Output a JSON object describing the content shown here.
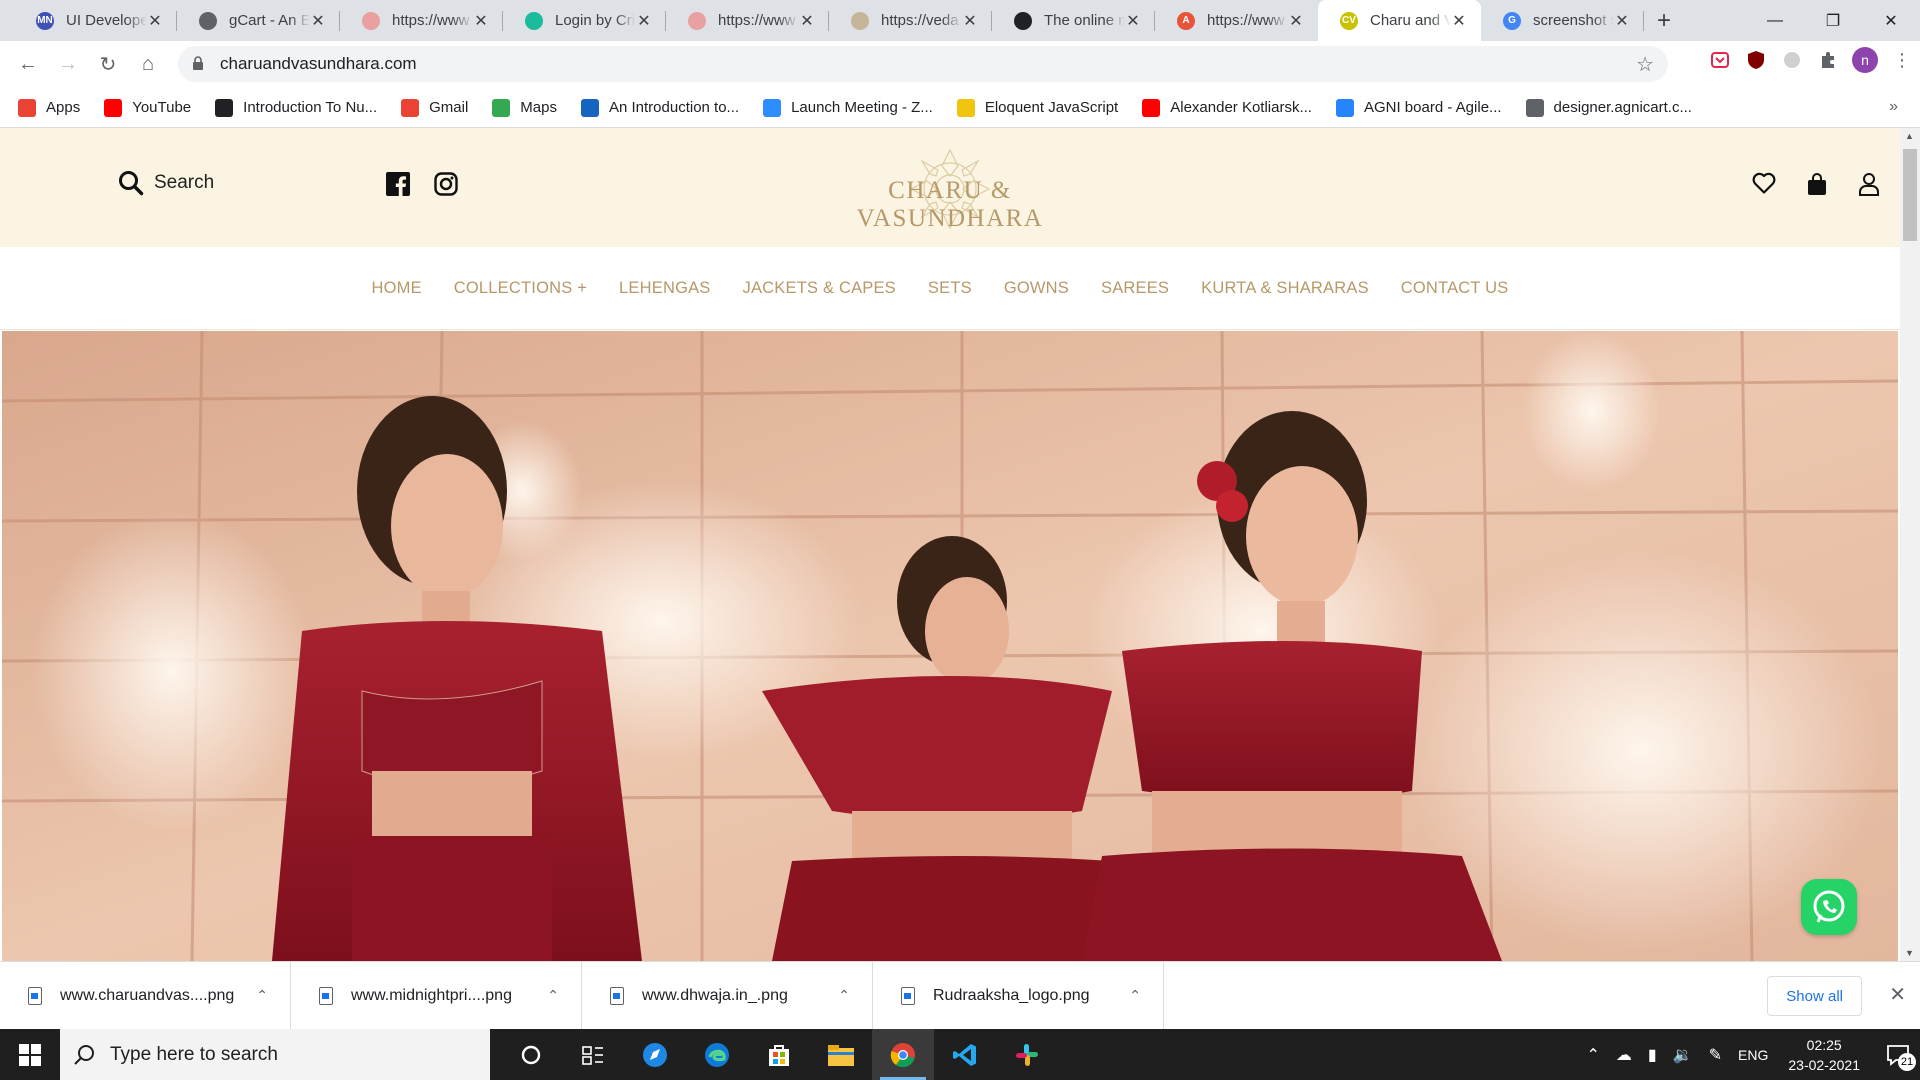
{
  "browser": {
    "tabs": [
      {
        "title": "UI Developer",
        "favicon_text": "MN",
        "favicon_color": "#3f51b5"
      },
      {
        "title": "gCart - An E",
        "favicon_text": "",
        "favicon_color": "#5f6368"
      },
      {
        "title": "https://www",
        "favicon_text": "",
        "favicon_color": "#e8a0a0"
      },
      {
        "title": "Login by Cri",
        "favicon_text": "",
        "favicon_color": "#1abc9c"
      },
      {
        "title": "https://www",
        "favicon_text": "",
        "favicon_color": "#e8a0a0"
      },
      {
        "title": "https://veda",
        "favicon_text": "",
        "favicon_color": "#c7b59a"
      },
      {
        "title": "The online m",
        "favicon_text": "",
        "favicon_color": "#202124"
      },
      {
        "title": "https://www",
        "favicon_text": "A",
        "favicon_color": "#e8533a"
      },
      {
        "title": "Charu and V",
        "favicon_text": "CV",
        "favicon_color": "#c9c200"
      },
      {
        "title": "screenshot s",
        "favicon_text": "G",
        "favicon_color": "#4285f4"
      }
    ],
    "active_tab_index": 8,
    "url": "charuandvasundhara.com",
    "profile_initial": "n",
    "bookmarks": [
      {
        "label": "Apps",
        "icon": "apps-grid-icon",
        "color": "#ea4335"
      },
      {
        "label": "YouTube",
        "icon": "youtube-icon",
        "color": "#ff0000"
      },
      {
        "label": "Introduction To Nu...",
        "icon": "bookmark-site-icon",
        "color": "#202124"
      },
      {
        "label": "Gmail",
        "icon": "gmail-icon",
        "color": "#ea4335"
      },
      {
        "label": "Maps",
        "icon": "maps-icon",
        "color": "#34a853"
      },
      {
        "label": "An Introduction to...",
        "icon": "s-icon",
        "color": "#1565c0"
      },
      {
        "label": "Launch Meeting - Z...",
        "icon": "zoom-icon",
        "color": "#2d8cff"
      },
      {
        "label": "Eloquent JavaScript",
        "icon": "ejs-icon",
        "color": "#f1c40f"
      },
      {
        "label": "Alexander Kotliarsk...",
        "icon": "youtube-icon",
        "color": "#ff0000"
      },
      {
        "label": "AGNI board - Agile...",
        "icon": "jira-icon",
        "color": "#2684ff"
      },
      {
        "label": "designer.agnicart.c...",
        "icon": "globe-icon",
        "color": "#5f6368"
      }
    ]
  },
  "site": {
    "search_label": "Search",
    "brand_name": "CHARU & VASUNDHARA",
    "nav": [
      "HOME",
      "COLLECTIONS +",
      "LEHENGAS",
      "JACKETS & CAPES",
      "SETS",
      "GOWNS",
      "SAREES",
      "KURTA & SHARARAS",
      "CONTACT US"
    ],
    "colors": {
      "header_bg": "#fbf4e2",
      "accent": "#b59968",
      "hero_wall": "#e2b59a",
      "outfit": "#9b1b2a"
    }
  },
  "downloads": {
    "items": [
      "www.charuandvas....png",
      "www.midnightpri....png",
      "www.dhwaja.in_.png",
      "Rudraaksha_logo.png"
    ],
    "show_all": "Show all"
  },
  "taskbar": {
    "search_placeholder": "Type here to search",
    "language": "ENG",
    "time": "02:25",
    "date": "23-02-2021",
    "notifications": "21"
  }
}
